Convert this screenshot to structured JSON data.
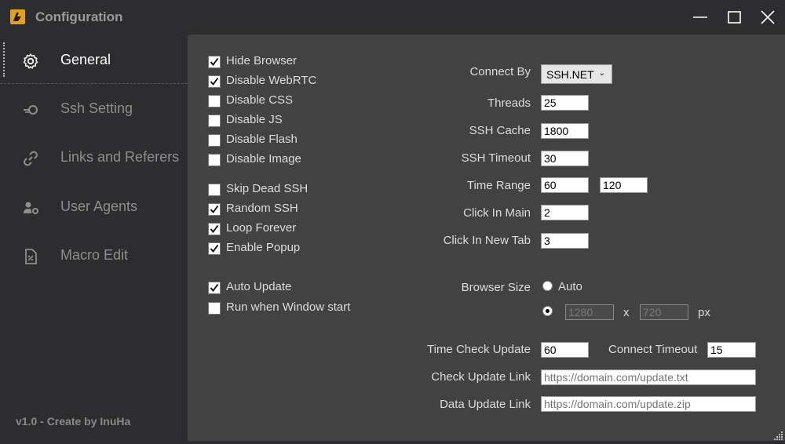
{
  "window": {
    "title": "Configuration"
  },
  "sidebar": {
    "items": [
      {
        "label": "General",
        "icon": "gear-icon",
        "active": true
      },
      {
        "label": "Ssh Setting",
        "icon": "ssh-icon"
      },
      {
        "label": "Links and Referers",
        "icon": "link-icon"
      },
      {
        "label": "User Agents",
        "icon": "user-gear-icon"
      },
      {
        "label": "Macro Edit",
        "icon": "macro-file-icon"
      }
    ],
    "version": "v1.0 - Create by InuHa"
  },
  "options": {
    "hide_browser": {
      "label": "Hide Browser",
      "checked": true
    },
    "disable_webrtc": {
      "label": "Disable WebRTC",
      "checked": true
    },
    "disable_css": {
      "label": "Disable CSS",
      "checked": false
    },
    "disable_js": {
      "label": "Disable JS",
      "checked": false
    },
    "disable_flash": {
      "label": "Disable Flash",
      "checked": false
    },
    "disable_image": {
      "label": "Disable Image",
      "checked": false
    },
    "skip_dead_ssh": {
      "label": "Skip Dead SSH",
      "checked": false
    },
    "random_ssh": {
      "label": "Random SSH",
      "checked": true
    },
    "loop_forever": {
      "label": "Loop Forever",
      "checked": true
    },
    "enable_popup": {
      "label": "Enable Popup",
      "checked": true
    },
    "auto_update": {
      "label": "Auto Update",
      "checked": true
    },
    "run_on_start": {
      "label": "Run when Window start",
      "checked": false
    }
  },
  "settings": {
    "connect_by": {
      "label": "Connect By",
      "value": "SSH.NET"
    },
    "threads": {
      "label": "Threads",
      "value": "25"
    },
    "ssh_cache": {
      "label": "SSH Cache",
      "value": "1800"
    },
    "ssh_timeout": {
      "label": "SSH Timeout",
      "value": "30"
    },
    "time_range": {
      "label": "Time Range",
      "min": "60",
      "max": "120"
    },
    "click_in_main": {
      "label": "Click In Main",
      "value": "2"
    },
    "click_in_new_tab": {
      "label": "Click In New Tab",
      "value": "3"
    },
    "browser_size": {
      "label": "Browser Size",
      "auto_label": "Auto",
      "width": "1280",
      "x_label": "x",
      "height": "720",
      "unit": "px",
      "selected": "custom"
    },
    "time_check_update": {
      "label": "Time Check Update",
      "value": "60"
    },
    "connect_timeout": {
      "label": "Connect Timeout",
      "value": "15"
    },
    "check_update_link": {
      "label": "Check Update Link",
      "placeholder": "https://domain.com/update.txt"
    },
    "data_update_link": {
      "label": "Data Update Link",
      "placeholder": "https://domain.com/update.zip"
    }
  },
  "colors": {
    "sidebar_bg": "#2d2d30",
    "content_bg": "#424242",
    "app_icon": "#e0a020"
  }
}
